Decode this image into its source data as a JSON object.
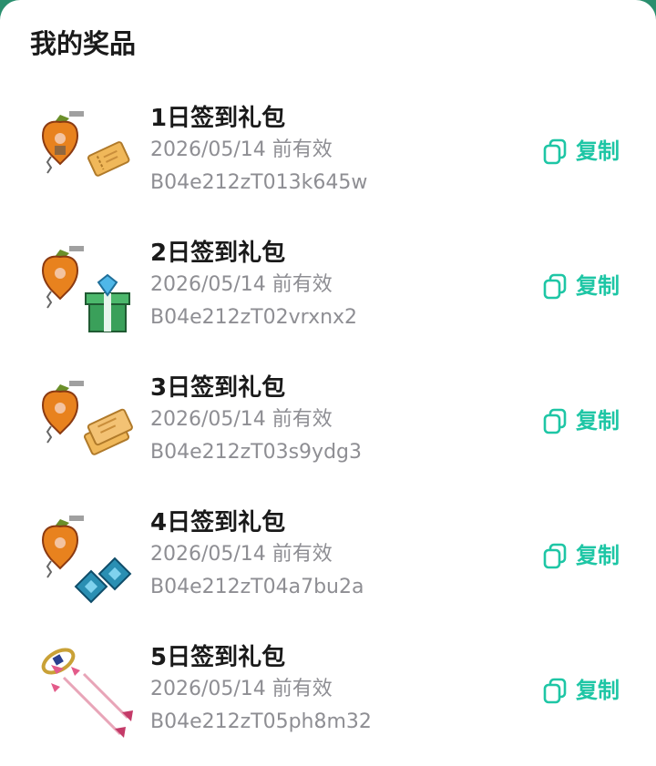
{
  "title": "我的奖品",
  "accent_color": "#1ec6a5",
  "copy_icon": "copy-icon",
  "items": [
    {
      "name": "1日签到礼包",
      "expiry": "2026/05/14 前有效",
      "code": "B04e212zT013k645w",
      "copy_label": "复制",
      "image": "apple-charm-and-ticket"
    },
    {
      "name": "2日签到礼包",
      "expiry": "2026/05/14 前有效",
      "code": "B04e212zT02vrxnx2",
      "copy_label": "复制",
      "image": "apple-charm-and-gift-box"
    },
    {
      "name": "3日签到礼包",
      "expiry": "2026/05/14 前有效",
      "code": "B04e212zT03s9ydg3",
      "copy_label": "复制",
      "image": "apple-charm-and-tickets"
    },
    {
      "name": "4日签到礼包",
      "expiry": "2026/05/14 前有效",
      "code": "B04e212zT04a7bu2a",
      "copy_label": "复制",
      "image": "apple-charm-and-gems"
    },
    {
      "name": "5日签到礼包",
      "expiry": "2026/05/14 前有效",
      "code": "B04e212zT05ph8m32",
      "copy_label": "复制",
      "image": "ring-and-arrows"
    }
  ]
}
